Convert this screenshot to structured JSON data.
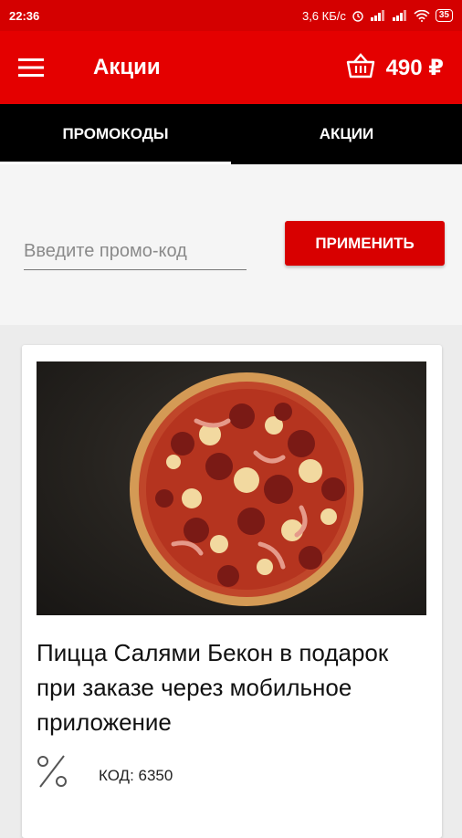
{
  "status_bar": {
    "time": "22:36",
    "network_speed": "3,6 КБ/с",
    "battery": "35"
  },
  "app_bar": {
    "title": "Акции",
    "cart_total": "490 ₽",
    "icons": {
      "menu": "hamburger-menu-icon",
      "cart": "shopping-basket-icon"
    }
  },
  "tabs": [
    {
      "label": "ПРОМОКОДЫ",
      "active": true
    },
    {
      "label": "АКЦИИ",
      "active": false
    }
  ],
  "promo": {
    "placeholder": "Введите промо-код",
    "value": "",
    "apply_label": "ПРИМЕНИТЬ"
  },
  "offers": [
    {
      "text": "Пицца Салями Бекон в подарок при заказе через мобильное приложение",
      "code_label": "КОД: 6350",
      "icon": "percent-icon"
    }
  ],
  "colors": {
    "status_bar": "#d40000",
    "app_bar": "#e40000",
    "tabs_bg": "#000000",
    "accent": "#d80000"
  }
}
